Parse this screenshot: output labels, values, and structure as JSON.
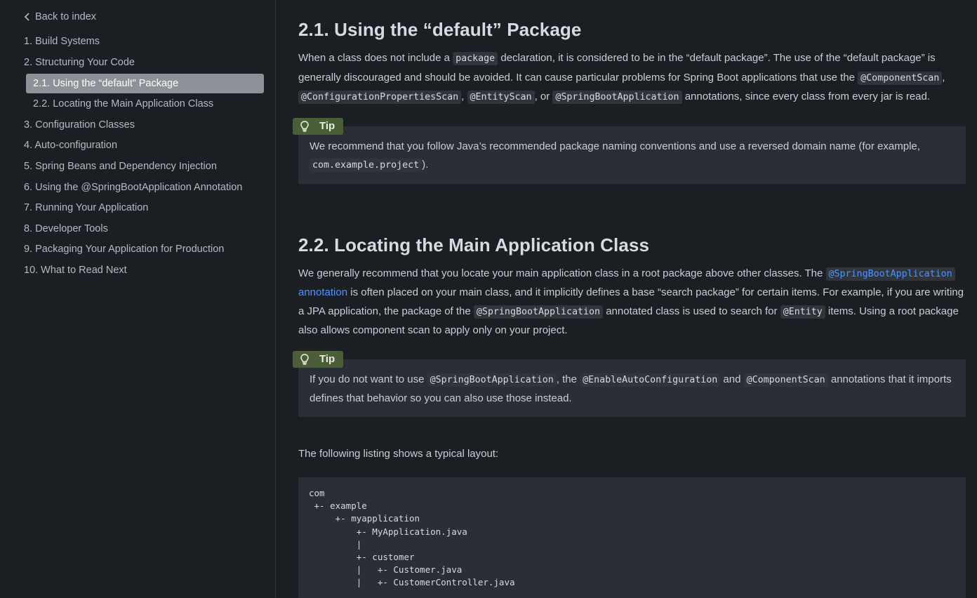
{
  "sidebar": {
    "back_label": "Back to index",
    "items": [
      {
        "label": "1. Build Systems",
        "level": 0
      },
      {
        "label": "2. Structuring Your Code",
        "level": 0
      },
      {
        "label": "2.1. Using the “default” Package",
        "level": 1,
        "active": true
      },
      {
        "label": "2.2. Locating the Main Application Class",
        "level": 1
      },
      {
        "label": "3. Configuration Classes",
        "level": 0
      },
      {
        "label": "4. Auto-configuration",
        "level": 0
      },
      {
        "label": "5. Spring Beans and Dependency Injection",
        "level": 0
      },
      {
        "label": "6. Using the @SpringBootApplication Annotation",
        "level": 0
      },
      {
        "label": "7. Running Your Application",
        "level": 0
      },
      {
        "label": "8. Developer Tools",
        "level": 0
      },
      {
        "label": "9. Packaging Your Application for Production",
        "level": 0
      },
      {
        "label": "10. What to Read Next",
        "level": 0
      }
    ]
  },
  "sections": {
    "s21": {
      "title": "2.1. Using the “default” Package",
      "p1_a": "When a class does not include a ",
      "p1_code1": "package",
      "p1_b": " declaration, it is considered to be in the “default package”. The use of the “default package” is generally discouraged and should be avoided. It can cause particular problems for Spring Boot applications that use the ",
      "p1_code2": "@ComponentScan",
      "p1_c": ", ",
      "p1_code3": "@ConfigurationPropertiesScan",
      "p1_d": ", ",
      "p1_code4": "@EntityScan",
      "p1_e": ", or ",
      "p1_code5": "@SpringBootApplication",
      "p1_f": " annotations, since every class from every jar is read.",
      "tip_label": "Tip",
      "tip_a": "We recommend that you follow Java’s recommended package naming conventions and use a reversed domain name (for example, ",
      "tip_code": "com.example.project",
      "tip_b": ")."
    },
    "s22": {
      "title": "2.2. Locating the Main Application Class",
      "p1_a": "We generally recommend that you locate your main application class in a root package above other classes. The ",
      "p1_link_code": "@SpringBootApplication",
      "p1_link_text": " annotation",
      "p1_b": " is often placed on your main class, and it implicitly defines a base “search package” for certain items. For example, if you are writing a JPA application, the package of the ",
      "p1_code2": "@SpringBootApplication",
      "p1_c": " annotated class is used to search for ",
      "p1_code3": "@Entity",
      "p1_d": " items. Using a root package also allows component scan to apply only on your project.",
      "tip_label": "Tip",
      "tip_a": "If you do not want to use ",
      "tip_code1": "@SpringBootApplication",
      "tip_b": ", the ",
      "tip_code2": "@EnableAutoConfiguration",
      "tip_c": " and ",
      "tip_code3": "@ComponentScan",
      "tip_d": " annotations that it imports defines that behavior so you can also use those instead.",
      "listing_intro": "The following listing shows a typical layout:",
      "listing": "com\n +- example\n     +- myapplication\n         +- MyApplication.java\n         |\n         +- customer\n         |   +- Customer.java\n         |   +- CustomerController.java"
    }
  },
  "colors": {
    "background": "#1b1f24",
    "sidebar_active": "#8d9299",
    "tip_label": "#4a5e38",
    "link": "#4d93ff",
    "code_bg": "#30353c"
  }
}
